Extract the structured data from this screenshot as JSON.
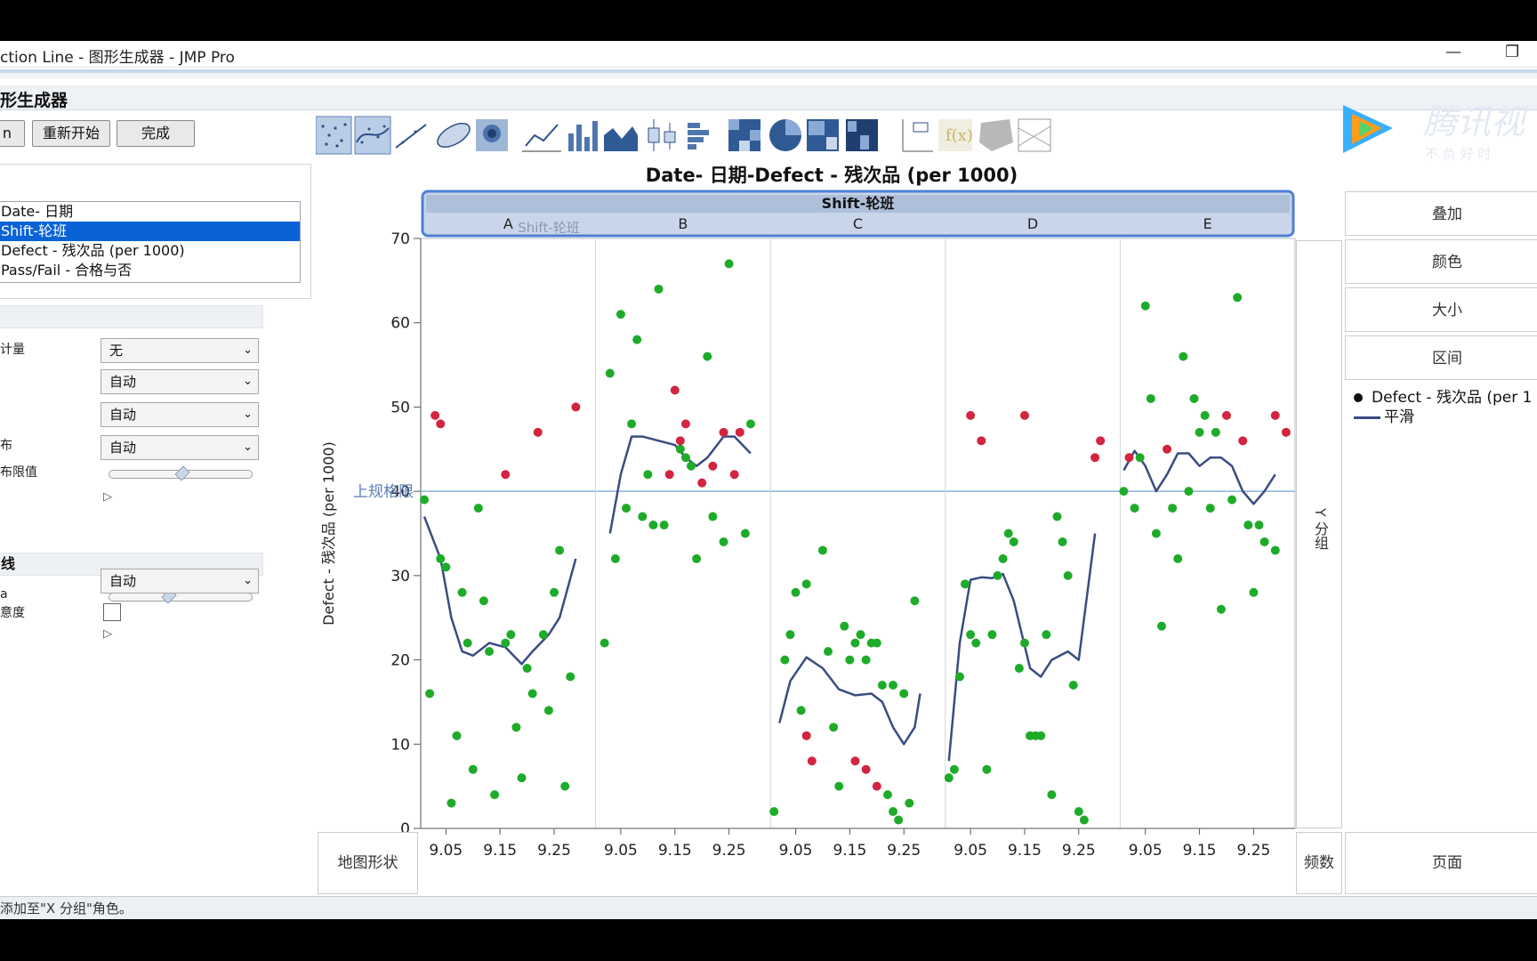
{
  "window": {
    "title": "ction Line - 图形生成器 - JMP Pro",
    "minimize_glyph": "—",
    "restore_glyph": "❐"
  },
  "panel": {
    "title": "形生成器"
  },
  "buttons": {
    "undo": "n",
    "restart": "重新开始",
    "done": "完成"
  },
  "variables": [
    {
      "label": "Date- 日期",
      "selected": false
    },
    {
      "label": "Shift-轮班",
      "selected": true
    },
    {
      "label": "Defect - 残次品 (per 1000)",
      "selected": false
    },
    {
      "label": "Pass/Fail - 合格与否",
      "selected": false
    }
  ],
  "options": {
    "stat_label": "计量",
    "stat_value": "无",
    "row2_value": "自动",
    "row3_value": "自动",
    "dist_label": "布",
    "dist_value": "自动",
    "limit_label": "布限值",
    "smoother_section": "线",
    "lambda_label": "a",
    "smoother_value": "自动",
    "conf_label": "意度"
  },
  "toolbar_icons": [
    "points-icon",
    "contour-points-icon",
    "line-of-fit-icon",
    "ellipse-icon",
    "density-icon",
    "line-chart-icon",
    "bar-chart-icon",
    "area-chart-icon",
    "box-plot-icon",
    "histogram-icon",
    "heatmap-icon",
    "pie-chart-icon",
    "treemap-icon",
    "mosaic-icon",
    "caption-box-icon",
    "formula-icon",
    "map-shapes-icon",
    "parallel-icon"
  ],
  "roles": {
    "overlay": "叠加",
    "color": "颜色",
    "size": "大小",
    "interval": "区间",
    "y_group": "Y 分组",
    "freq": "频数",
    "page": "页面",
    "map_shape": "地图形状"
  },
  "legend": {
    "points_label": "Defect - 残次品 (per 1",
    "smooth_label": "平滑"
  },
  "status": {
    "text": "添加至\"X 分组\"角色。"
  },
  "watermark": {
    "brand": "腾讯视",
    "slogan": "不 负 好 时"
  },
  "colors": {
    "pass": "#1fab2a",
    "fail": "#d2253f",
    "smooth": "#3a4d80",
    "limit": "#8fb0d9",
    "selection": "#0a63d6"
  },
  "chart_data": {
    "type": "scatter",
    "title": "Date- 日期-Defect - 残次品 (per 1000)",
    "facet_title": "Shift-轮班",
    "facet_drop_hint": "Shift-轮班",
    "xlabel": "Date- 日期",
    "ylabel": "Defect - 残次品 (per 1000)",
    "ylim": [
      0,
      70
    ],
    "yticks": [
      0,
      10,
      20,
      30,
      40,
      50,
      60,
      70
    ],
    "xlim": [
      9.01,
      9.32
    ],
    "xticks": [
      9.05,
      9.15,
      9.25
    ],
    "xtick_labels": [
      "9.05",
      "9.15",
      "9.25"
    ],
    "reference_line": {
      "value": 40,
      "label": "上规格限"
    },
    "panels": [
      {
        "name": "A",
        "green": [
          [
            9.01,
            39
          ],
          [
            9.02,
            16
          ],
          [
            9.04,
            32
          ],
          [
            9.05,
            31
          ],
          [
            9.06,
            3
          ],
          [
            9.07,
            11
          ],
          [
            9.08,
            28
          ],
          [
            9.09,
            22
          ],
          [
            9.1,
            7
          ],
          [
            9.11,
            38
          ],
          [
            9.12,
            27
          ],
          [
            9.13,
            21
          ],
          [
            9.14,
            4
          ],
          [
            9.16,
            22
          ],
          [
            9.17,
            23
          ],
          [
            9.18,
            12
          ],
          [
            9.19,
            6
          ],
          [
            9.2,
            19
          ],
          [
            9.21,
            16
          ],
          [
            9.23,
            23
          ],
          [
            9.24,
            14
          ],
          [
            9.25,
            28
          ],
          [
            9.26,
            33
          ],
          [
            9.27,
            5
          ],
          [
            9.28,
            18
          ]
        ],
        "red": [
          [
            9.03,
            49
          ],
          [
            9.04,
            48
          ],
          [
            9.16,
            42
          ],
          [
            9.22,
            47
          ],
          [
            9.29,
            50
          ]
        ],
        "smooth": [
          [
            9.01,
            37
          ],
          [
            9.04,
            32
          ],
          [
            9.06,
            25
          ],
          [
            9.08,
            21
          ],
          [
            9.1,
            20.5
          ],
          [
            9.13,
            22
          ],
          [
            9.16,
            21.5
          ],
          [
            9.19,
            19.5
          ],
          [
            9.21,
            21
          ],
          [
            9.24,
            23
          ],
          [
            9.26,
            25
          ],
          [
            9.29,
            32
          ]
        ]
      },
      {
        "name": "B",
        "green": [
          [
            9.02,
            22
          ],
          [
            9.03,
            54
          ],
          [
            9.04,
            32
          ],
          [
            9.05,
            61
          ],
          [
            9.06,
            38
          ],
          [
            9.07,
            48
          ],
          [
            9.08,
            58
          ],
          [
            9.09,
            37
          ],
          [
            9.1,
            42
          ],
          [
            9.11,
            36
          ],
          [
            9.12,
            64
          ],
          [
            9.13,
            36
          ],
          [
            9.16,
            45
          ],
          [
            9.17,
            44
          ],
          [
            9.18,
            43
          ],
          [
            9.19,
            32
          ],
          [
            9.21,
            56
          ],
          [
            9.22,
            37
          ],
          [
            9.24,
            34
          ],
          [
            9.25,
            67
          ],
          [
            9.28,
            35
          ],
          [
            9.29,
            48
          ]
        ],
        "red": [
          [
            9.14,
            42
          ],
          [
            9.15,
            52
          ],
          [
            9.16,
            46
          ],
          [
            9.17,
            48
          ],
          [
            9.2,
            41
          ],
          [
            9.22,
            43
          ],
          [
            9.24,
            47
          ],
          [
            9.26,
            42
          ],
          [
            9.27,
            47
          ]
        ],
        "smooth": [
          [
            9.03,
            35
          ],
          [
            9.05,
            42
          ],
          [
            9.07,
            46.5
          ],
          [
            9.09,
            46.5
          ],
          [
            9.12,
            46
          ],
          [
            9.15,
            45.5
          ],
          [
            9.17,
            44
          ],
          [
            9.19,
            43
          ],
          [
            9.21,
            44
          ],
          [
            9.24,
            46.5
          ],
          [
            9.26,
            46.5
          ],
          [
            9.29,
            44.5
          ]
        ]
      },
      {
        "name": "C",
        "green": [
          [
            9.01,
            2
          ],
          [
            9.03,
            20
          ],
          [
            9.04,
            23
          ],
          [
            9.05,
            28
          ],
          [
            9.06,
            14
          ],
          [
            9.07,
            29
          ],
          [
            9.1,
            33
          ],
          [
            9.11,
            21
          ],
          [
            9.12,
            12
          ],
          [
            9.13,
            5
          ],
          [
            9.14,
            24
          ],
          [
            9.15,
            20
          ],
          [
            9.16,
            22
          ],
          [
            9.17,
            23
          ],
          [
            9.18,
            20
          ],
          [
            9.19,
            22
          ],
          [
            9.2,
            22
          ],
          [
            9.21,
            17
          ],
          [
            9.22,
            4
          ],
          [
            9.23,
            17
          ],
          [
            9.24,
            1
          ],
          [
            9.25,
            16
          ],
          [
            9.26,
            3
          ],
          [
            9.27,
            27
          ],
          [
            9.23,
            2
          ]
        ],
        "red": [
          [
            9.07,
            11
          ],
          [
            9.08,
            8
          ],
          [
            9.16,
            8
          ],
          [
            9.18,
            7
          ],
          [
            9.2,
            5
          ]
        ],
        "smooth": [
          [
            9.02,
            12.5
          ],
          [
            9.04,
            17.5
          ],
          [
            9.07,
            20.3
          ],
          [
            9.1,
            19
          ],
          [
            9.13,
            16.5
          ],
          [
            9.16,
            15.8
          ],
          [
            9.19,
            16
          ],
          [
            9.21,
            15
          ],
          [
            9.23,
            12
          ],
          [
            9.25,
            10
          ],
          [
            9.27,
            12
          ],
          [
            9.28,
            16
          ]
        ]
      },
      {
        "name": "D",
        "green": [
          [
            9.01,
            6
          ],
          [
            9.02,
            7
          ],
          [
            9.03,
            18
          ],
          [
            9.04,
            29
          ],
          [
            9.05,
            23
          ],
          [
            9.06,
            22
          ],
          [
            9.08,
            7
          ],
          [
            9.09,
            23
          ],
          [
            9.1,
            30
          ],
          [
            9.11,
            32
          ],
          [
            9.12,
            35
          ],
          [
            9.13,
            34
          ],
          [
            9.14,
            19
          ],
          [
            9.15,
            22
          ],
          [
            9.16,
            11
          ],
          [
            9.17,
            11
          ],
          [
            9.18,
            11
          ],
          [
            9.19,
            23
          ],
          [
            9.2,
            4
          ],
          [
            9.21,
            37
          ],
          [
            9.22,
            34
          ],
          [
            9.23,
            30
          ],
          [
            9.24,
            17
          ],
          [
            9.25,
            2
          ],
          [
            9.26,
            1
          ]
        ],
        "red": [
          [
            9.05,
            49
          ],
          [
            9.07,
            46
          ],
          [
            9.15,
            49
          ],
          [
            9.28,
            44
          ],
          [
            9.29,
            46
          ]
        ],
        "smooth": [
          [
            9.01,
            8
          ],
          [
            9.03,
            22
          ],
          [
            9.05,
            29.5
          ],
          [
            9.07,
            29.8
          ],
          [
            9.09,
            29.7
          ],
          [
            9.11,
            30.2
          ],
          [
            9.13,
            27
          ],
          [
            9.16,
            19
          ],
          [
            9.18,
            18
          ],
          [
            9.2,
            20
          ],
          [
            9.23,
            21
          ],
          [
            9.25,
            20
          ],
          [
            9.28,
            35
          ]
        ]
      },
      {
        "name": "E",
        "green": [
          [
            9.01,
            40
          ],
          [
            9.03,
            38
          ],
          [
            9.04,
            44
          ],
          [
            9.05,
            62
          ],
          [
            9.06,
            51
          ],
          [
            9.07,
            35
          ],
          [
            9.08,
            24
          ],
          [
            9.1,
            38
          ],
          [
            9.11,
            32
          ],
          [
            9.12,
            56
          ],
          [
            9.13,
            40
          ],
          [
            9.14,
            51
          ],
          [
            9.15,
            47
          ],
          [
            9.16,
            49
          ],
          [
            9.17,
            38
          ],
          [
            9.18,
            47
          ],
          [
            9.19,
            26
          ],
          [
            9.21,
            39
          ],
          [
            9.22,
            63
          ],
          [
            9.24,
            36
          ],
          [
            9.25,
            28
          ],
          [
            9.26,
            36
          ],
          [
            9.27,
            34
          ],
          [
            9.29,
            33
          ]
        ],
        "red": [
          [
            9.02,
            44
          ],
          [
            9.09,
            45
          ],
          [
            9.2,
            49
          ],
          [
            9.23,
            46
          ],
          [
            9.29,
            49
          ],
          [
            9.31,
            47
          ]
        ],
        "smooth": [
          [
            9.01,
            42.5
          ],
          [
            9.03,
            44.8
          ],
          [
            9.05,
            43
          ],
          [
            9.07,
            40
          ],
          [
            9.09,
            42
          ],
          [
            9.11,
            44.5
          ],
          [
            9.13,
            44.5
          ],
          [
            9.15,
            43
          ],
          [
            9.17,
            44
          ],
          [
            9.19,
            44
          ],
          [
            9.21,
            43
          ],
          [
            9.23,
            40
          ],
          [
            9.25,
            38.5
          ],
          [
            9.27,
            40
          ],
          [
            9.29,
            42
          ]
        ]
      }
    ]
  }
}
